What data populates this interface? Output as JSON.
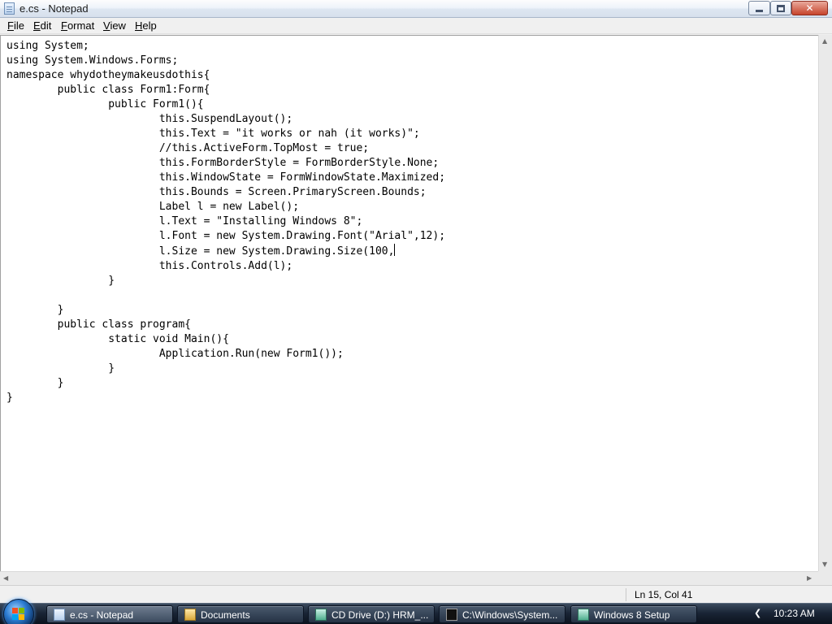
{
  "window": {
    "title": "e.cs - Notepad",
    "controls": {
      "minimize": "minimize",
      "maximize": "maximize",
      "close": "✕"
    }
  },
  "menu": {
    "items": [
      {
        "label": "File"
      },
      {
        "label": "Edit"
      },
      {
        "label": "Format"
      },
      {
        "label": "View"
      },
      {
        "label": "Help"
      }
    ]
  },
  "editor": {
    "lines": [
      "using System;",
      "using System.Windows.Forms;",
      "namespace whydotheymakeusdothis{",
      "        public class Form1:Form{",
      "                public Form1(){",
      "                        this.SuspendLayout();",
      "                        this.Text = \"it works or nah (it works)\";",
      "                        //this.ActiveForm.TopMost = true;",
      "                        this.FormBorderStyle = FormBorderStyle.None;",
      "                        this.WindowState = FormWindowState.Maximized;",
      "                        this.Bounds = Screen.PrimaryScreen.Bounds;",
      "                        Label l = new Label();",
      "                        l.Text = \"Installing Windows 8\";",
      "                        l.Font = new System.Drawing.Font(\"Arial\",12);",
      "                        l.Size = new System.Drawing.Size(100,",
      "                        this.Controls.Add(l);",
      "                }",
      "",
      "        }",
      "        public class program{",
      "                static void Main(){",
      "                        Application.Run(new Form1());",
      "                }",
      "        }",
      "}"
    ]
  },
  "status": {
    "position": "Ln 15, Col 41"
  },
  "taskbar": {
    "buttons": [
      {
        "label": "e.cs - Notepad",
        "icon": "notepad-icon",
        "active": true
      },
      {
        "label": "Documents",
        "icon": "folder-icon",
        "active": false
      },
      {
        "label": "CD Drive (D:) HRM_...",
        "icon": "cd-drive-icon",
        "active": false
      },
      {
        "label": "C:\\Windows\\System...",
        "icon": "console-icon",
        "active": false
      },
      {
        "label": "Windows 8 Setup",
        "icon": "setup-icon",
        "active": false
      }
    ],
    "clock": "10:23 AM"
  },
  "colors": {
    "taskbar": "#1a2536",
    "window_chrome": "#f0f0f0",
    "close_button": "#c7442c"
  }
}
